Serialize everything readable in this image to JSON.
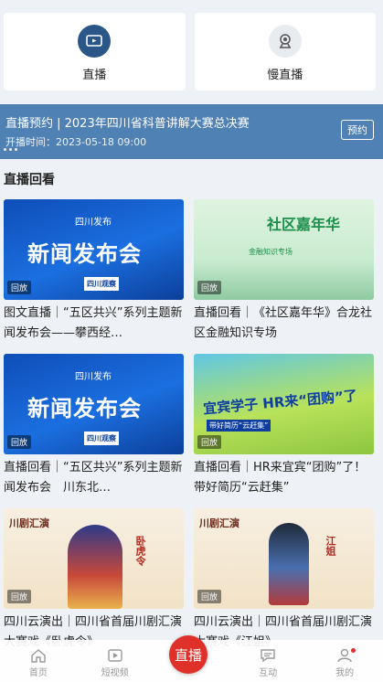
{
  "top_cards": [
    {
      "label": "直播",
      "icon": "live-play-icon"
    },
    {
      "label": "慢直播",
      "icon": "camera-icon"
    }
  ],
  "banner": {
    "title": "直播预约 | 2023年四川省科普讲解大赛总决赛",
    "time": "开播时间：2023-05-18 09:00",
    "button": "预约"
  },
  "section_title": "直播回看",
  "cards": [
    {
      "thumb_text": "新闻发布会",
      "thumb_logo": "四川发布",
      "thumb_badge": "四川观察",
      "tag": "回放",
      "title": "图文直播｜“五区共兴”系列主题新闻发布会——攀西经…"
    },
    {
      "thumb_text": "社区嘉年华",
      "thumb_sub": "金融知识专场",
      "tag": "回放",
      "title": "直播回看｜《社区嘉年华》合龙社区金融知识专场"
    },
    {
      "thumb_text": "新闻发布会",
      "thumb_logo": "四川发布",
      "thumb_badge": "四川观察",
      "tag": "回放",
      "title": "直播回看｜“五区共兴”系列主题新闻发布会　川东北…"
    },
    {
      "thumb_text": "宜宾学子 HR来“团购”了",
      "thumb_sub": "带好简历“云赶集”",
      "tag": "回放",
      "title": "直播回看｜HR来宜宾“团购”了！带好简历“云赶集”"
    },
    {
      "thumb_text": "川剧汇演",
      "thumb_sub": "卧虎令",
      "tag": "回放",
      "title": "四川云演出｜四川省首届川剧汇演大赛戏《卧虎令》"
    },
    {
      "thumb_text": "川剧汇演",
      "thumb_sub": "江姐",
      "tag": "回放",
      "title": "四川云演出｜四川省首届川剧汇演大赛戏《江姐》"
    }
  ],
  "tabbar": {
    "items": [
      {
        "label": "首页",
        "icon": "home-icon"
      },
      {
        "label": "短视频",
        "icon": "video-icon"
      },
      {
        "label": "互动",
        "icon": "chat-icon"
      },
      {
        "label": "我的",
        "icon": "user-icon"
      }
    ],
    "center": "直播"
  },
  "colors": {
    "accent": "#e0302a",
    "banner": "#4f81b4",
    "icon_dark": "#2a5688"
  }
}
